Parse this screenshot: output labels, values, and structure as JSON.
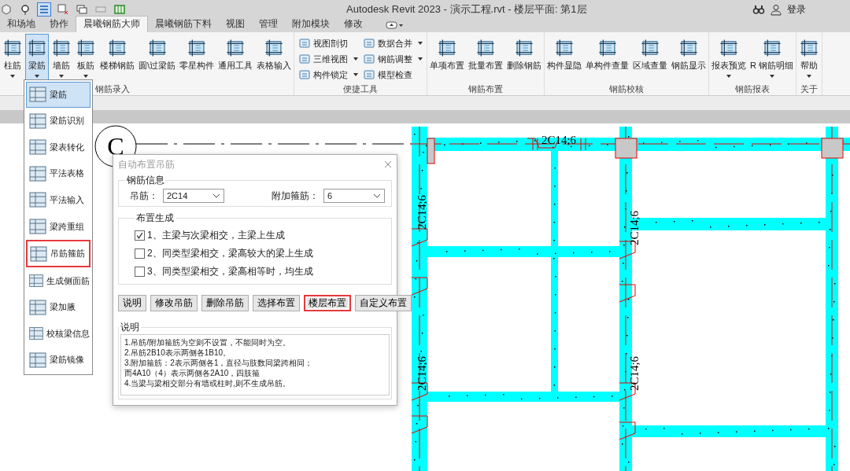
{
  "title_bar": {
    "title": "Autodesk Revit 2023 - 演示工程.rvt - 楼层平面: 第1层",
    "login": "登录"
  },
  "tabs": [
    {
      "label": "和场地",
      "selected": false
    },
    {
      "label": "协作",
      "selected": false
    },
    {
      "label": "晨曦钢筋大师",
      "selected": true
    },
    {
      "label": "晨曦钢筋下料",
      "selected": false
    },
    {
      "label": "视图",
      "selected": false
    },
    {
      "label": "管理",
      "selected": false
    },
    {
      "label": "附加模块",
      "selected": false
    },
    {
      "label": "修改",
      "selected": false
    }
  ],
  "ribbon_groups": [
    {
      "label": "钢筋录入",
      "kind": "large",
      "buttons": [
        {
          "label": "柱筋",
          "dropdown": true,
          "selected": false
        },
        {
          "label": "梁筋",
          "dropdown": true,
          "selected": true
        },
        {
          "label": "墙筋",
          "dropdown": true,
          "selected": false
        },
        {
          "label": "板筋",
          "dropdown": true,
          "selected": false
        },
        {
          "label": "楼梯钢筋",
          "dropdown": false,
          "selected": false
        },
        {
          "label": "圆\\过梁筋",
          "dropdown": false,
          "selected": false
        },
        {
          "label": "零星构件",
          "dropdown": false,
          "selected": false
        },
        {
          "label": "通用工具",
          "dropdown": false,
          "selected": false
        },
        {
          "label": "表格输入",
          "dropdown": false,
          "selected": false
        }
      ]
    },
    {
      "label": "便捷工具",
      "kind": "small",
      "buttons": [
        {
          "label": "视图剖切",
          "dropdown": false,
          "selected": false
        },
        {
          "label": "三维视图",
          "dropdown": true,
          "selected": false
        },
        {
          "label": "构件锁定",
          "dropdown": true,
          "selected": false
        },
        {
          "label": "数据合并",
          "dropdown": true,
          "selected": false
        },
        {
          "label": "钢筋调整",
          "dropdown": true,
          "selected": false
        },
        {
          "label": "模型检查",
          "dropdown": false,
          "selected": false
        }
      ]
    },
    {
      "label": "钢筋布置",
      "kind": "large",
      "buttons": [
        {
          "label": "单项布置",
          "dropdown": false,
          "selected": false
        },
        {
          "label": "批量布置",
          "dropdown": false,
          "selected": false
        },
        {
          "label": "删除钢筋",
          "dropdown": false,
          "selected": false
        }
      ]
    },
    {
      "label": "钢筋校核",
      "kind": "large",
      "buttons": [
        {
          "label": "构件显隐",
          "dropdown": false,
          "selected": false
        },
        {
          "label": "单构件查量",
          "dropdown": false,
          "selected": false
        },
        {
          "label": "区域查量",
          "dropdown": false,
          "selected": false
        },
        {
          "label": "钢筋显示",
          "dropdown": false,
          "selected": false
        }
      ]
    },
    {
      "label": "钢筋报表",
      "kind": "large",
      "buttons": [
        {
          "label": "报表预览",
          "dropdown": true,
          "selected": false
        },
        {
          "label": "R 钢筋明细",
          "dropdown": true,
          "selected": false
        }
      ]
    },
    {
      "label": "关于",
      "kind": "large",
      "buttons": [
        {
          "label": "帮助",
          "dropdown": true,
          "selected": false
        }
      ]
    }
  ],
  "dropdown_menu": [
    {
      "label": "梁筋",
      "selected": true,
      "marked": false
    },
    {
      "label": "梁筋识别",
      "selected": false,
      "marked": false
    },
    {
      "label": "梁表转化",
      "selected": false,
      "marked": false
    },
    {
      "label": "平法表格",
      "selected": false,
      "marked": false
    },
    {
      "label": "平法输入",
      "selected": false,
      "marked": false
    },
    {
      "label": "梁跨重组",
      "selected": false,
      "marked": false
    },
    {
      "label": "吊筋箍筋",
      "selected": false,
      "marked": true
    },
    {
      "label": "生成侧面筋",
      "selected": false,
      "marked": false
    },
    {
      "label": "梁加腋",
      "selected": false,
      "marked": false
    },
    {
      "label": "校核梁信息",
      "selected": false,
      "marked": false
    },
    {
      "label": "梁筋镜像",
      "selected": false,
      "marked": false
    }
  ],
  "canvas": {
    "grid_bubble": "C",
    "rebar_labels": [
      "2C14;6",
      "2C14;6",
      "2C14;6",
      "2C14;6",
      "2C14;6"
    ]
  },
  "dialog": {
    "title": "自动布置吊筋",
    "rebar_info": {
      "legend": "钢筋信息",
      "fields": [
        {
          "label": "吊筋：",
          "value": "2C14"
        },
        {
          "label": "附加箍筋：",
          "value": "6"
        }
      ]
    },
    "generation": {
      "legend": "布置生成",
      "options": [
        {
          "label": "1、主梁与次梁相交，主梁上生成",
          "checked": true
        },
        {
          "label": "2、同类型梁相交，梁高较大的梁上生成",
          "checked": false
        },
        {
          "label": "3、同类型梁相交，梁高相等时，均生成",
          "checked": false
        }
      ]
    },
    "buttons": [
      {
        "label": "说明",
        "marked": false
      },
      {
        "label": "修改吊筋",
        "marked": false
      },
      {
        "label": "删除吊筋",
        "marked": false
      },
      {
        "label": "选择布置",
        "marked": false
      },
      {
        "label": "楼层布置",
        "marked": true
      },
      {
        "label": "自定义布置",
        "marked": false
      }
    ],
    "notes": {
      "legend": "说明",
      "lines": [
        "1.吊筋/附加箍筋为空则不设置，不能同时为空。",
        "2.吊筋2B10表示两侧各1B10。",
        "3.附加箍筋：2表示两侧各1，直径与肢数同梁跨相同；",
        "而4A10（4）表示两侧各2A10，四肢箍",
        "4.当梁与梁相交部分有墙或柱时,则不生成吊筋。"
      ]
    }
  }
}
